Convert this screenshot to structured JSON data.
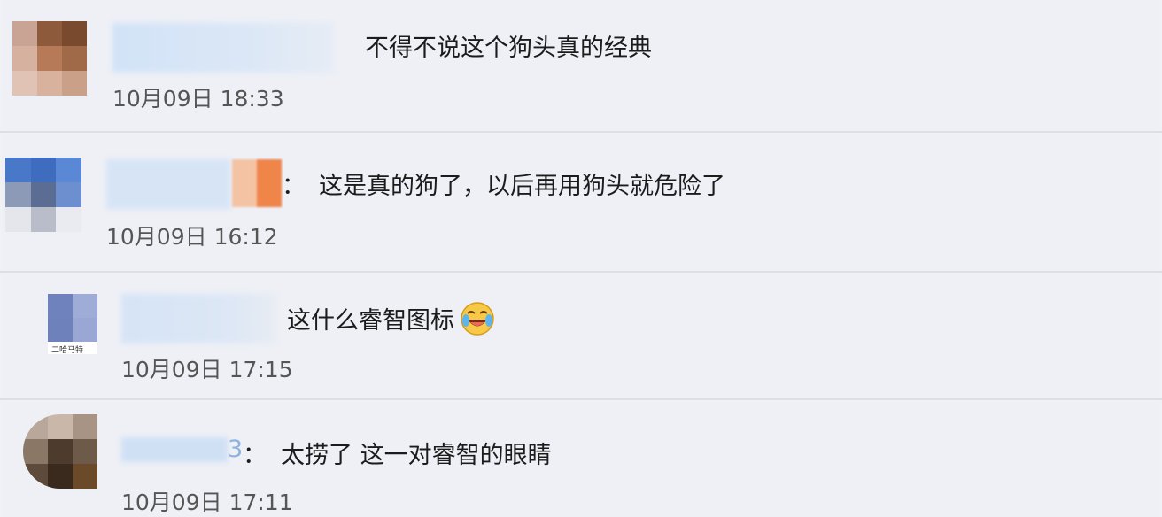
{
  "comments": [
    {
      "text": "不得不说这个狗头真的经典",
      "time": "10月09日 18:33"
    },
    {
      "prefix": "：",
      "text": "这是真的狗了，以后再用狗头就危险了",
      "time": "10月09日 16:12"
    },
    {
      "text": "这什么睿智图标",
      "emoji": "laugh-cry-icon",
      "time": "10月09日 17:15",
      "avatar_tag": "二哈马特"
    },
    {
      "name_tail": "3",
      "prefix": "：",
      "text": "太捞了 这一对睿智的眼睛",
      "time": "10月09日 17:11"
    }
  ],
  "colors": {
    "background": "#eef0f6",
    "separator": "#dcdfe6",
    "name_blur": "#cfe0f5"
  }
}
